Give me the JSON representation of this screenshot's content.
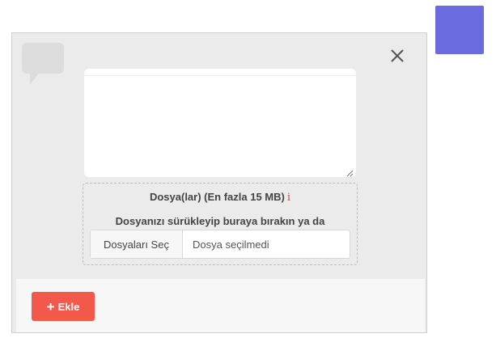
{
  "colors": {
    "accent_badge": "#6b6be0",
    "add_button": "#f2594b",
    "info_icon": "#e0463c",
    "modal_bg": "#ebebeb"
  },
  "icons": {
    "chat": "chat-bubble-icon",
    "close": "close-icon",
    "info": "info-icon",
    "plus": "plus-icon",
    "resize": "resize-grip-icon"
  },
  "message": {
    "value": ""
  },
  "upload": {
    "title": "Dosya(lar) (En fazla 15 MB)",
    "info_glyph": "i",
    "hint": "Dosyanızı sürükleyip buraya bırakın ya da",
    "choose_label": "Dosyaları Seç",
    "no_file_label": "Dosya seçilmedi"
  },
  "footer": {
    "add_plus": "+",
    "add_label": "Ekle"
  }
}
